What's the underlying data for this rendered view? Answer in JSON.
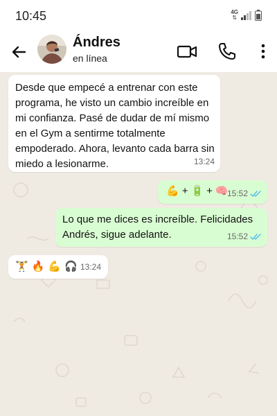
{
  "status_bar": {
    "time": "10:45",
    "network": "4G"
  },
  "contact": {
    "name": "Ándres",
    "status": "en línea"
  },
  "messages": [
    {
      "direction": "in",
      "text": "Desde que empecé a entrenar con este programa, he visto un cambio increíble en mi confianza. Pasé de dudar de mí mismo en el Gym a sentirme totalmente empoderado. Ahora, levanto cada barra sin miedo a lesionarme.",
      "time": "13:24"
    },
    {
      "direction": "out",
      "emojis": [
        "💪",
        "+",
        "🔋",
        "+",
        "🧠"
      ],
      "time": "15:52",
      "read": true
    },
    {
      "direction": "out",
      "text": "Lo que me dices es increíble. Felicidades Andrés, sigue adelante.",
      "time": "15:52",
      "read": true
    },
    {
      "direction": "in",
      "emojis": [
        "🏋",
        "🔥",
        "💪",
        "🎧"
      ],
      "time": "13:24"
    }
  ],
  "colors": {
    "incoming_bubble": "#ffffff",
    "outgoing_bubble": "#d9fdd3",
    "read_ticks": "#53bdeb",
    "chat_background": "#efeae2"
  }
}
